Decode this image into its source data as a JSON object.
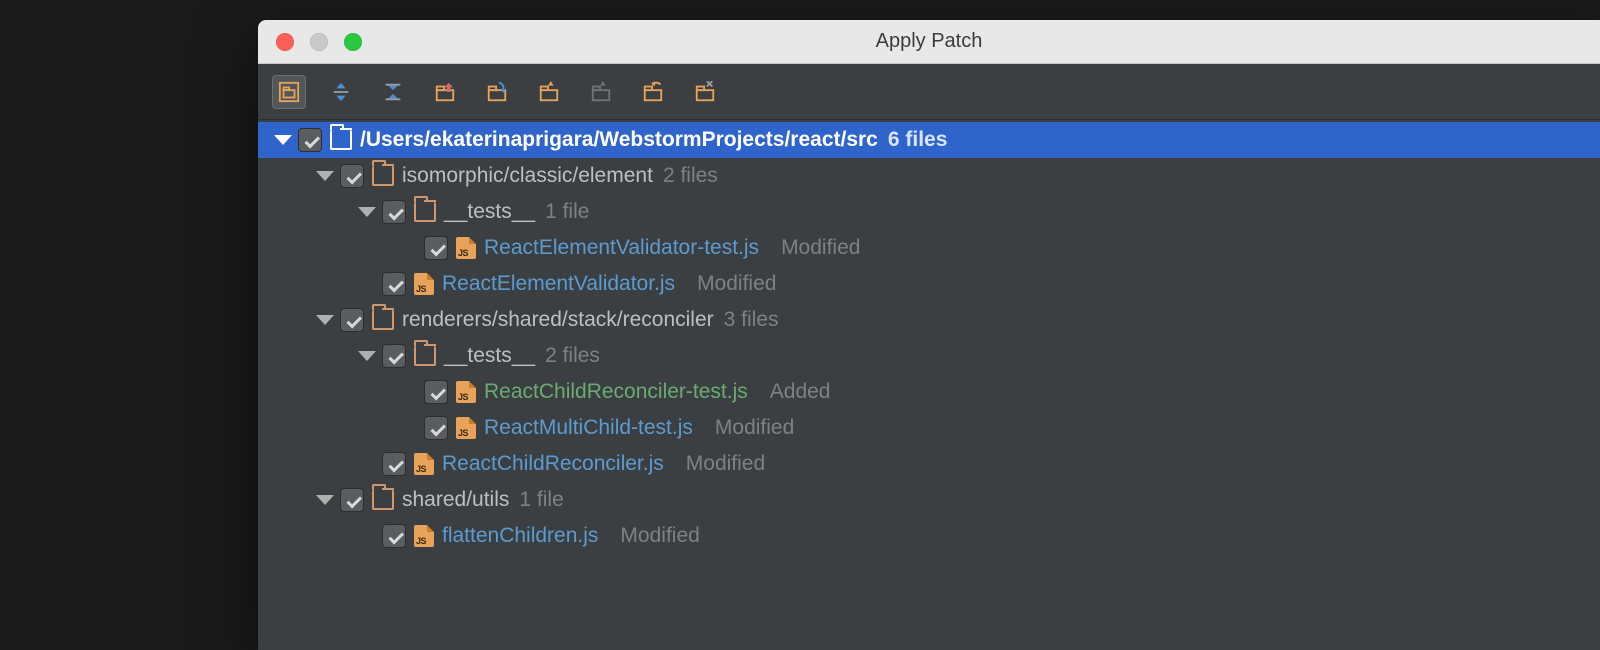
{
  "window": {
    "title": "Apply Patch"
  },
  "toolbar": {
    "buttons": [
      {
        "name": "group-by-directory",
        "active": true
      },
      {
        "name": "expand-all",
        "active": false
      },
      {
        "name": "collapse-all",
        "active": false
      },
      {
        "name": "pull-folder",
        "active": false
      },
      {
        "name": "drop-folder",
        "active": false
      },
      {
        "name": "open-folder",
        "active": false
      },
      {
        "name": "gray-folder",
        "active": false
      },
      {
        "name": "revert-folder",
        "active": false
      },
      {
        "name": "delete-folder",
        "active": false
      }
    ]
  },
  "tree": {
    "root": {
      "path": "/Users/ekaterinaprigara/WebstormProjects/react/src",
      "count": "6 files",
      "checked": true,
      "selected": true
    },
    "rows": [
      {
        "depth": 1,
        "type": "folder",
        "expand": true,
        "label": "isomorphic/classic/element",
        "count": "2 files",
        "labelClass": "lightgray"
      },
      {
        "depth": 2,
        "type": "folder",
        "expand": true,
        "label": "__tests__",
        "count": "1 file",
        "labelClass": "lightgray"
      },
      {
        "depth": 3,
        "type": "file",
        "label": "ReactElementValidator-test.js",
        "status": "Modified",
        "labelClass": "blue"
      },
      {
        "depth": 2,
        "type": "file",
        "label": "ReactElementValidator.js",
        "status": "Modified",
        "labelClass": "blue"
      },
      {
        "depth": 1,
        "type": "folder",
        "expand": true,
        "label": "renderers/shared/stack/reconciler",
        "count": "3 files",
        "labelClass": "lightgray"
      },
      {
        "depth": 2,
        "type": "folder",
        "expand": true,
        "label": "__tests__",
        "count": "2 files",
        "labelClass": "lightgray"
      },
      {
        "depth": 3,
        "type": "file",
        "label": "ReactChildReconciler-test.js",
        "status": "Added",
        "labelClass": "green"
      },
      {
        "depth": 3,
        "type": "file",
        "label": "ReactMultiChild-test.js",
        "status": "Modified",
        "labelClass": "blue"
      },
      {
        "depth": 2,
        "type": "file",
        "label": "ReactChildReconciler.js",
        "status": "Modified",
        "labelClass": "blue"
      },
      {
        "depth": 1,
        "type": "folder",
        "expand": true,
        "label": "shared/utils",
        "count": "1 file",
        "labelClass": "lightgray"
      },
      {
        "depth": 2,
        "type": "file",
        "label": "flattenChildren.js",
        "status": "Modified",
        "labelClass": "blue"
      }
    ]
  }
}
